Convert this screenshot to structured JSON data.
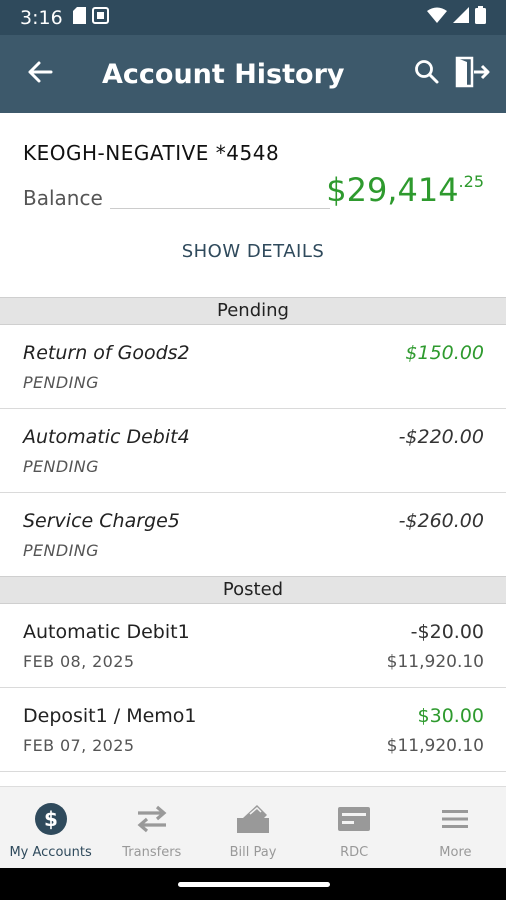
{
  "status_bar": {
    "time": "3:16"
  },
  "header": {
    "title": "Account History"
  },
  "account": {
    "name": "KEOGH-NEGATIVE *4548",
    "balance_label": "Balance",
    "balance_dollars": "$29,414",
    "balance_cents": ".25",
    "show_details": "SHOW DETAILS"
  },
  "pending": {
    "title": "Pending",
    "items": [
      {
        "desc": "Return of Goods2",
        "status": "PENDING",
        "amount": "$150.00"
      },
      {
        "desc": "Automatic Debit4",
        "status": "PENDING",
        "amount": "-$220.00"
      },
      {
        "desc": "Service Charge5",
        "status": "PENDING",
        "amount": "-$260.00"
      }
    ]
  },
  "posted": {
    "title": "Posted",
    "items": [
      {
        "desc": "Automatic Debit1",
        "date": "FEB 08, 2025",
        "amount": "-$20.00",
        "balance": "$11,920.10"
      },
      {
        "desc": "Deposit1 / Memo1",
        "date": "FEB 07, 2025",
        "amount": "$30.00",
        "balance": "$11,920.10"
      }
    ]
  },
  "nav": {
    "items": [
      {
        "label": "My Accounts",
        "icon": "dollar-circle-icon"
      },
      {
        "label": "Transfers",
        "icon": "transfer-arrows-icon"
      },
      {
        "label": "Bill Pay",
        "icon": "bill-pay-icon"
      },
      {
        "label": "RDC",
        "icon": "check-deposit-icon"
      },
      {
        "label": "More",
        "icon": "menu-icon"
      }
    ]
  },
  "colors": {
    "header": "#3d596b",
    "status_bar": "#2f4a5c",
    "positive": "#2e9a2e",
    "active_nav": "#2f4a5c"
  }
}
